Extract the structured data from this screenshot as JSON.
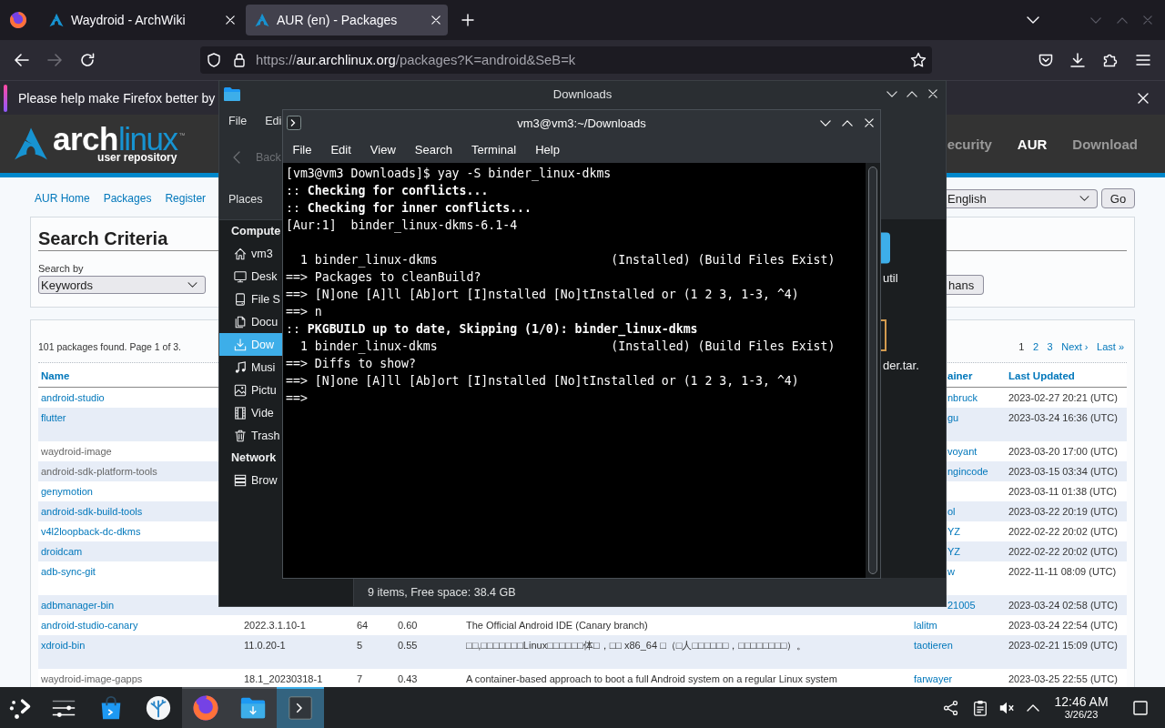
{
  "browser": {
    "tabs": [
      {
        "title": "Waydroid - ArchWiki",
        "selected": false
      },
      {
        "title": "AUR (en) - Packages",
        "selected": true
      }
    ],
    "back_button": {
      "disabled": false
    },
    "forward_button": {
      "disabled": true
    },
    "address": {
      "scheme": "https://",
      "host": "aur.archlinux.org",
      "path": "/packages?K=android&SeB=k"
    },
    "notification": {
      "text": "Please help make Firefox better by"
    }
  },
  "aur": {
    "logo": {
      "first": "arch",
      "second": "linux",
      "trademark": "™",
      "tagline": "user repository"
    },
    "nav": [
      {
        "label": "ecurity",
        "selected": false
      },
      {
        "label": "AUR",
        "selected": true
      },
      {
        "label": "Download",
        "selected": false
      }
    ],
    "links": [
      "AUR Home",
      "Packages",
      "Register"
    ],
    "language": {
      "value": "English"
    },
    "go_button": "Go",
    "search": {
      "title": "Search Criteria",
      "search_by_label": "Search by",
      "search_by_value": "Keywords",
      "button": "hans"
    },
    "results": {
      "summary": "101 packages found. Page 1 of 3.",
      "pages": [
        {
          "label": "1",
          "selected": true
        },
        {
          "label": "2",
          "selected": false
        },
        {
          "label": "3",
          "selected": false
        },
        {
          "label": "Next ›",
          "selected": false
        },
        {
          "label": "Last »",
          "selected": false
        }
      ],
      "header": {
        "name": "Name",
        "column_6": "ainer",
        "last_updated": "Last Updated"
      },
      "rows": [
        {
          "kind": "covered",
          "name": "android-studio",
          "column_6": "nbruck",
          "last_updated": "2023-02-27 20:21 (UTC)",
          "visited": false,
          "wrapped": false
        },
        {
          "kind": "covered",
          "name": "flutter",
          "column_6": "gu",
          "last_updated": "2023-03-24 16:36 (UTC)",
          "visited": false,
          "wrapped": true
        },
        {
          "kind": "covered",
          "name": "waydroid-image",
          "column_6": "voyant",
          "last_updated": "2023-03-20 17:00 (UTC)",
          "visited": true,
          "wrapped": false
        },
        {
          "kind": "covered",
          "name": "android-sdk-platform-tools",
          "column_6": "ngincode",
          "last_updated": "2023-03-15 03:34 (UTC)",
          "visited": true,
          "wrapped": false
        },
        {
          "kind": "covered",
          "name": "genymotion",
          "last_updated": "2023-03-11 01:38 (UTC)",
          "visited": false,
          "wrapped": false
        },
        {
          "kind": "covered",
          "name": "android-sdk-build-tools",
          "column_6": "ol",
          "last_updated": "2023-03-22 20:19 (UTC)",
          "visited": false,
          "wrapped": false
        },
        {
          "kind": "covered",
          "name": "v4l2loopback-dc-dkms",
          "column_6": "YZ",
          "last_updated": "2022-02-22 20:02 (UTC)",
          "visited": false,
          "wrapped": false
        },
        {
          "kind": "covered",
          "name": "droidcam",
          "column_6": "YZ",
          "last_updated": "2022-02-22 20:02 (UTC)",
          "visited": false,
          "wrapped": false
        },
        {
          "kind": "covered",
          "name": "adb-sync-git",
          "column_6": "w",
          "last_updated": "2022-11-11 08:09 (UTC)",
          "visited": false,
          "wrapped": true
        },
        {
          "kind": "covered",
          "name": "adbmanager-bin",
          "column_6": "21005",
          "last_updated": "2023-03-24 02:58 (UTC)",
          "visited": false,
          "wrapped": false
        },
        {
          "kind": "full",
          "name": "android-studio-canary",
          "column_2": "2022.3.1.10-1",
          "column_3": "64",
          "column_4": "0.60",
          "column_5": "The Official Android IDE (Canary branch)",
          "column_6": "lalitm",
          "last_updated": "2023-03-24 22:54 (UTC)",
          "visited": false,
          "wrapped": false
        },
        {
          "kind": "full",
          "name": "xdroid-bin",
          "column_2": "11.0.20-1",
          "column_3": "5",
          "column_4": "0.55",
          "column_5": "□□,□□□□□□□Linux□□□□□□体□，□□ x86_64 □（□人□□□□□□，□□□□□□□□）。",
          "column_6": "taotieren",
          "last_updated": "2023-02-21 15:09 (UTC)",
          "visited": false,
          "wrapped": true
        },
        {
          "kind": "full",
          "name": "waydroid-image-gapps",
          "column_2": "18.1_20230318-1",
          "column_3": "7",
          "column_4": "0.43",
          "column_5": "A container-based approach to boot a full Android system on a regular Linux system",
          "column_6": "farwayer",
          "last_updated": "2023-03-25 22:55 (UTC)",
          "visited": true,
          "wrapped": false
        }
      ]
    }
  },
  "file_manager": {
    "title": "Downloads",
    "menu": [
      "File",
      "Edi"
    ],
    "back": {
      "label": "Back",
      "disabled": true
    },
    "places_label": "Places",
    "groups": [
      {
        "label": "Compute",
        "items": [
          {
            "label": "vm3",
            "selected": false
          },
          {
            "label": "Desk",
            "selected": false
          },
          {
            "label": "File S",
            "selected": false
          },
          {
            "label": "Docu",
            "selected": false
          },
          {
            "label": "Dow",
            "selected": true
          },
          {
            "label": "Musi",
            "selected": false
          },
          {
            "label": "Pictu",
            "selected": false
          },
          {
            "label": "Vide",
            "selected": false
          },
          {
            "label": "Trash",
            "selected": false
          }
        ]
      },
      {
        "label": "Network",
        "items": [
          {
            "label": "Brow",
            "selected": false
          }
        ]
      }
    ],
    "files": [
      {
        "label": "util"
      },
      {
        "label": "der.tar."
      }
    ],
    "status": "9 items, Free space: 38.4 GB"
  },
  "terminal": {
    "title": "vm3@vm3:~/Downloads",
    "menu": [
      "File",
      "Edit",
      "View",
      "Search",
      "Terminal",
      "Help"
    ],
    "blocks": [
      [
        "[vm3@vm3 Downloads]$ yay -S binder_linux-dkms",
        ":: **Checking for conflicts...**",
        ":: **Checking for inner conflicts...**",
        "[Aur:1]  binder_linux-dkms-6.1-4"
      ],
      [
        "  1 binder_linux-dkms                        (Installed) (Build Files Exist)",
        "==> Packages to cleanBuild?",
        "==> [N]one [A]ll [Ab]ort [I]nstalled [No]tInstalled or (1 2 3, 1-3, ^4)",
        "==> n",
        ":: **PKGBUILD up to date, Skipping (1/0): binder_linux-dkms**",
        "  1 binder_linux-dkms                        (Installed) (Build Files Exist)",
        "==> Diffs to show?",
        "==> [N]one [A]ll [Ab]ort [I]nstalled [No]tInstalled or (1 2 3, 1-3, ^4)",
        "==>"
      ]
    ]
  },
  "taskbar": {
    "tasks": [
      {
        "selected": false,
        "open": false
      },
      {
        "selected": false,
        "open": false
      },
      {
        "selected": false,
        "open": false
      },
      {
        "selected": false,
        "open": false
      },
      {
        "selected": false,
        "open": true
      },
      {
        "selected": false,
        "open": true
      },
      {
        "selected": true,
        "open": true
      }
    ],
    "clock": {
      "time": "12:46 AM",
      "date": "3/26/23"
    }
  }
}
